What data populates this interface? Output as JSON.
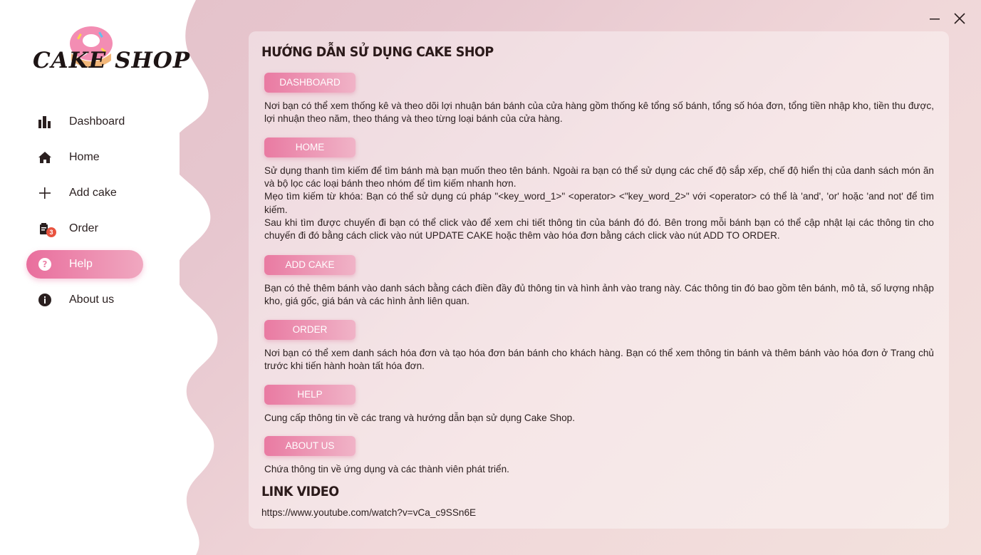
{
  "app": {
    "logo_text": "CAKE SHOP"
  },
  "sidebar": {
    "items": [
      {
        "label": "Dashboard",
        "icon": "bar-chart-icon"
      },
      {
        "label": "Home",
        "icon": "home-icon"
      },
      {
        "label": "Add cake",
        "icon": "plus-icon"
      },
      {
        "label": "Order",
        "icon": "order-icon",
        "badge": "3"
      },
      {
        "label": "Help",
        "icon": "help-icon",
        "active": true
      },
      {
        "label": "About us",
        "icon": "info-icon"
      }
    ]
  },
  "window": {
    "minimize": "minimize-icon",
    "close": "close-icon"
  },
  "colors": {
    "accent": "#e96e9d",
    "badge": "#e8533f"
  },
  "main": {
    "title": "HƯỚNG DẪN SỬ DỤNG CAKE SHOP",
    "sections": [
      {
        "label": "DASHBOARD",
        "lines": [
          "Nơi bạn có thể xem thống kê và theo dõi lợi nhuận bán bánh của cửa hàng gồm thống kê tổng số bánh, tổng số hóa đơn, tổng tiền nhập kho, tiền thu được, lợi nhuận theo năm, theo tháng và theo từng loại bánh của cửa hàng."
        ]
      },
      {
        "label": "HOME",
        "lines": [
          "Sử dụng thanh tìm kiếm để tìm bánh mà bạn muốn theo tên bánh. Ngoài ra bạn có thể sử dụng các chế độ sắp xếp, chế độ hiển thị của danh sách món ăn và bộ lọc các loại bánh theo nhóm để tìm kiếm nhanh hơn.",
          "Mẹo tìm kiếm từ khóa: Bạn có thể sử dụng cú pháp \"<key_word_1>\" <operator> <\"key_word_2>\" với <operator> có thể là 'and', 'or' hoặc 'and not' để tìm kiếm.",
          "Sau khi tìm được chuyến đi bạn có thể click vào để xem chi tiết thông tin của bánh đó đó. Bên trong mỗi bánh bạn có thể cập nhật lại các thông tin cho chuyến đi đó bằng cách click vào nút UPDATE CAKE hoặc thêm vào hóa đơn bằng cách click vào nút ADD TO ORDER."
        ]
      },
      {
        "label": "ADD CAKE",
        "lines": [
          "Bạn có thẻ thêm bánh vào danh sách bằng cách điền đầy đủ thông tin và hình ảnh vào trang này. Các thông tin đó bao gồm tên bánh, mô tả, số lượng nhập kho, giá gốc, giá bán và các hình ảnh liên quan."
        ]
      },
      {
        "label": "ORDER",
        "lines": [
          "Nơi bạn có thể xem danh sách hóa đơn và tạo hóa đơn bán bánh cho khách hàng. Bạn có thể xem thông tin bánh và thêm bánh vào hóa đơn ở Trang chủ trước khi tiến hành hoàn tất hóa đơn."
        ]
      },
      {
        "label": "HELP",
        "lines": [
          "Cung cấp thông tin về các trang và hướng dẫn bạn sử dụng Cake Shop."
        ]
      },
      {
        "label": "ABOUT US",
        "lines": [
          "Chứa thông tin về ứng dụng và các thành viên phát triển."
        ]
      }
    ],
    "video_title": "LINK VIDEO",
    "video_link": "https://www.youtube.com/watch?v=vCa_c9SSn6E"
  }
}
